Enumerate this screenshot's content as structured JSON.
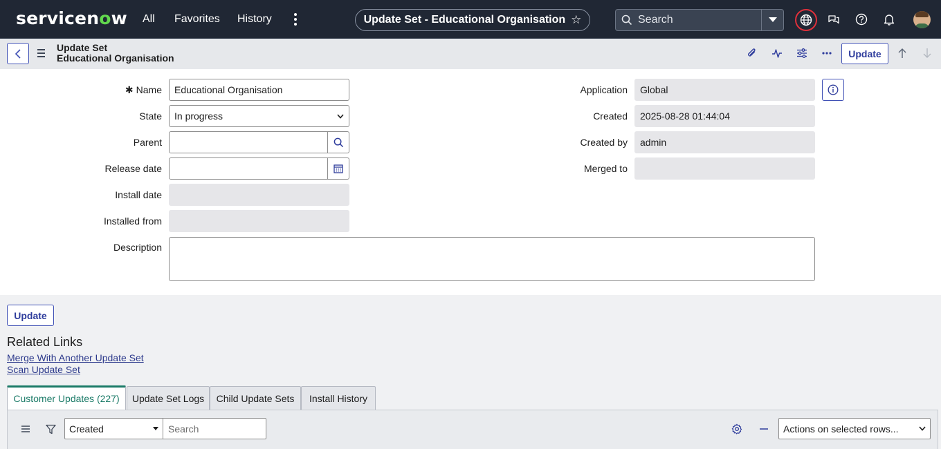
{
  "nav": {
    "logo_part1": "servicen",
    "logo_o": "o",
    "logo_part2": "w",
    "links": [
      "All",
      "Favorites",
      "History"
    ],
    "record_title": "Update Set - Educational Organisation",
    "search_placeholder": "Search"
  },
  "header": {
    "table_name": "Update Set",
    "record_name": "Educational Organisation",
    "update_label": "Update"
  },
  "form": {
    "name_label": "Name",
    "name_value": "Educational Organisation",
    "state_label": "State",
    "state_value": "In progress",
    "parent_label": "Parent",
    "parent_value": "",
    "release_date_label": "Release date",
    "release_date_value": "",
    "install_date_label": "Install date",
    "install_date_value": "",
    "installed_from_label": "Installed from",
    "installed_from_value": "",
    "description_label": "Description",
    "description_value": "",
    "application_label": "Application",
    "application_value": "Global",
    "created_label": "Created",
    "created_value": "2025-08-28 01:44:04",
    "created_by_label": "Created by",
    "created_by_value": "admin",
    "merged_to_label": "Merged to",
    "merged_to_value": ""
  },
  "bottom": {
    "update_label": "Update",
    "related_links_title": "Related Links",
    "links": [
      "Merge With Another Update Set",
      "Scan Update Set"
    ]
  },
  "tabs": [
    {
      "label": "Customer Updates (227)",
      "active": true
    },
    {
      "label": "Update Set Logs",
      "active": false
    },
    {
      "label": "Child Update Sets",
      "active": false
    },
    {
      "label": "Install History",
      "active": false
    }
  ],
  "list": {
    "field_select_value": "Created",
    "search_placeholder": "Search",
    "actions_value": "Actions on selected rows..."
  },
  "colors": {
    "nav_bg": "#202734",
    "accent": "#3f50b5",
    "active_tab": "#1a7a67",
    "globe_ring": "#e0303b"
  }
}
